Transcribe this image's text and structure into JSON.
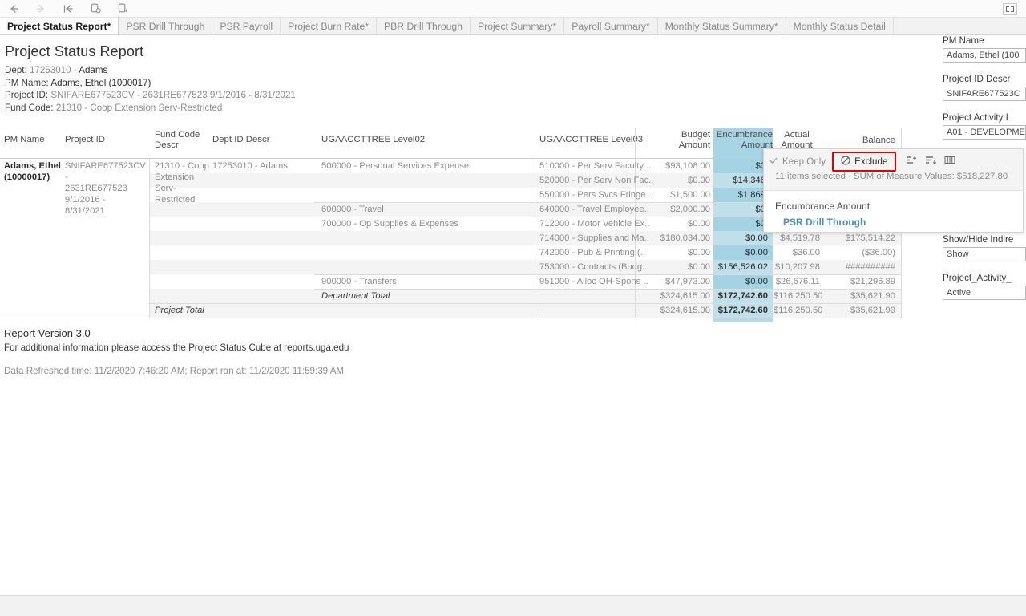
{
  "toolbar": {
    "buttons": [
      {
        "name": "back-icon",
        "glyph": "←",
        "enabled": true
      },
      {
        "name": "forward-icon",
        "glyph": "→",
        "enabled": false
      },
      {
        "name": "revert-all-icon",
        "glyph": "⇤",
        "enabled": true
      },
      {
        "name": "refresh-data-icon",
        "glyph": "↻",
        "enabled": true
      },
      {
        "name": "pause-auto-updates-icon",
        "glyph": "‖",
        "enabled": true
      }
    ],
    "fullscreen_label": "Full Screen"
  },
  "tabs": [
    {
      "label": "Project Status Report*",
      "active": true
    },
    {
      "label": "PSR Drill Through",
      "active": false
    },
    {
      "label": "PSR Payroll",
      "active": false
    },
    {
      "label": "Project Burn Rate*",
      "active": false
    },
    {
      "label": "PBR Drill Through",
      "active": false
    },
    {
      "label": "Project Summary*",
      "active": false
    },
    {
      "label": "Payroll Summary*",
      "active": false
    },
    {
      "label": "Monthly Status Summary*",
      "active": false
    },
    {
      "label": "Monthly Status Detail",
      "active": false
    }
  ],
  "report": {
    "title": "Project Status Report",
    "dept_label": "Dept:",
    "dept_code": "17253010 -",
    "dept_name": "Adams",
    "pm_label": "PM Name:",
    "pm_value": "Adams, Ethel (1000017)",
    "project_label": "Project ID:",
    "project_value": "SNIFARE677523CV - 2631RE677523 9/1/2016 - 8/31/2021",
    "fund_label": "Fund Code:",
    "fund_value": "21310 - Coop Extension Serv-Restricted"
  },
  "table": {
    "headers": {
      "pm_name": "PM Name",
      "project_id": "Project ID",
      "fund_code_descr": "Fund Code\nDescr",
      "fund_code_descr_l1": "Fund Code",
      "fund_code_descr_l2": "Descr",
      "dept_id_descr": "Dept ID Descr",
      "level02": "UGAACCTTREE Level02",
      "level03": "UGAACCTTREE Level03",
      "budget_l1": "Budget",
      "budget_l2": "Amount",
      "encumbrance_l1": "Encumbrance",
      "encumbrance_l2": "Amount",
      "actual_l1": "Actual",
      "actual_l2": "Amount",
      "balance": "Balance"
    },
    "group": {
      "pm_name": "Adams, Ethel (10000017)",
      "project_id": "SNIFARE677523CV - 2631RE677523 9/1/2016 - 8/31/2021",
      "project_id_lines": [
        "SNIFARE677523CV -",
        "2631RE677523",
        "9/1/2016 -",
        "8/31/2021"
      ],
      "fund_code_lines": [
        "21310 - Coop",
        "Extension",
        "Serv-",
        "Restricted"
      ],
      "dept_id_descr": "17253010 - Adams"
    },
    "rows": [
      {
        "level02": "500000 - Personal Services Expense",
        "level03": "510000 - Per Serv Faculty ..",
        "budget": "$93,108.00",
        "encumbrance": "$0.",
        "actual": "",
        "balance": "",
        "alt": false
      },
      {
        "level02": "",
        "level03": "520000 - Per Serv Non Fac..",
        "budget": "$0.00",
        "encumbrance": "$14,346.",
        "actual": "",
        "balance": "",
        "alt": true
      },
      {
        "level02": "",
        "level03": "550000 - Pers Svcs Fringe ..",
        "budget": "$1,500.00",
        "encumbrance": "$1,869.",
        "actual": "",
        "balance": "",
        "alt": false
      },
      {
        "level02": "600000 - Travel",
        "level03": "640000 - Travel Employee..",
        "budget": "$2,000.00",
        "encumbrance": "$0.",
        "actual": "",
        "balance": "",
        "alt": true
      },
      {
        "level02": "700000 - Op Supplies & Expenses",
        "level03": "712000 - Motor Vehicle Ex..",
        "budget": "$0.00",
        "encumbrance": "$0.",
        "actual": "",
        "balance": "",
        "alt": false
      },
      {
        "level02": "",
        "level03": "714000 - Supplies and Ma..",
        "budget": "$180,034.00",
        "encumbrance": "$0.00",
        "actual": "$4,519.78",
        "balance": "$175,514.22",
        "alt": true
      },
      {
        "level02": "",
        "level03": "742000 - Pub & Printing (..",
        "budget": "$0.00",
        "encumbrance": "$0.00",
        "actual": "$36.00",
        "balance": "($36.00)",
        "alt": false
      },
      {
        "level02": "",
        "level03": "753000 - Contracts (Budg..",
        "budget": "$0.00",
        "encumbrance": "$156,526.02",
        "actual": "$10,207.98",
        "balance": "##########",
        "alt": true
      },
      {
        "level02": "900000 - Transfers",
        "level03": "951000 - Alloc OH-Spons ..",
        "budget": "$47,973.00",
        "encumbrance": "$0.00",
        "actual": "$26,676.11",
        "balance": "$21,296.89",
        "alt": false
      }
    ],
    "department_total": {
      "label": "Department Total",
      "budget": "$324,615.00",
      "encumbrance": "$172,742.60",
      "actual": "$116,250.50",
      "balance": "$35,621.90"
    },
    "project_total": {
      "label": "Project Total",
      "budget": "$324,615.00",
      "encumbrance": "$172,742.60",
      "actual": "$116,250.50",
      "balance": "$35,621.90"
    }
  },
  "tooltip": {
    "keep_only": "Keep Only",
    "exclude": "Exclude",
    "keep_only_icon": "check-icon",
    "exclude_icon": "no-entry-icon",
    "group_members_icon": "group-members-icon",
    "sort_icon": "sort-icon",
    "view_data_icon": "view-data-icon",
    "selection_summary": "11 items selected  ·  SUM of Measure Values: $518,227.80",
    "measure_label": "Encumbrance Amount",
    "link_label": "PSR Drill Through",
    "highlight_color": "#e20000"
  },
  "filters": [
    {
      "label": "PM Name",
      "value": "Adams, Ethel (100"
    },
    {
      "label": "Project ID Descr",
      "value": "SNIFARE677523C"
    },
    {
      "label": "Project Activity I",
      "value": "A01 - DEVELOPME"
    },
    {
      "label": "Show/Hide Indire",
      "value": "Show"
    },
    {
      "label": "Project_Activity_",
      "value": "Active"
    }
  ],
  "footer": {
    "version": "Report Version 3.0",
    "info": "For additional information please access the Project Status Cube at reports.uga.edu",
    "refreshed": "Data Refreshed time: 11/2/2020 7:46:20 AM; Report ran at: 11/2/2020 11:59:39 AM"
  }
}
